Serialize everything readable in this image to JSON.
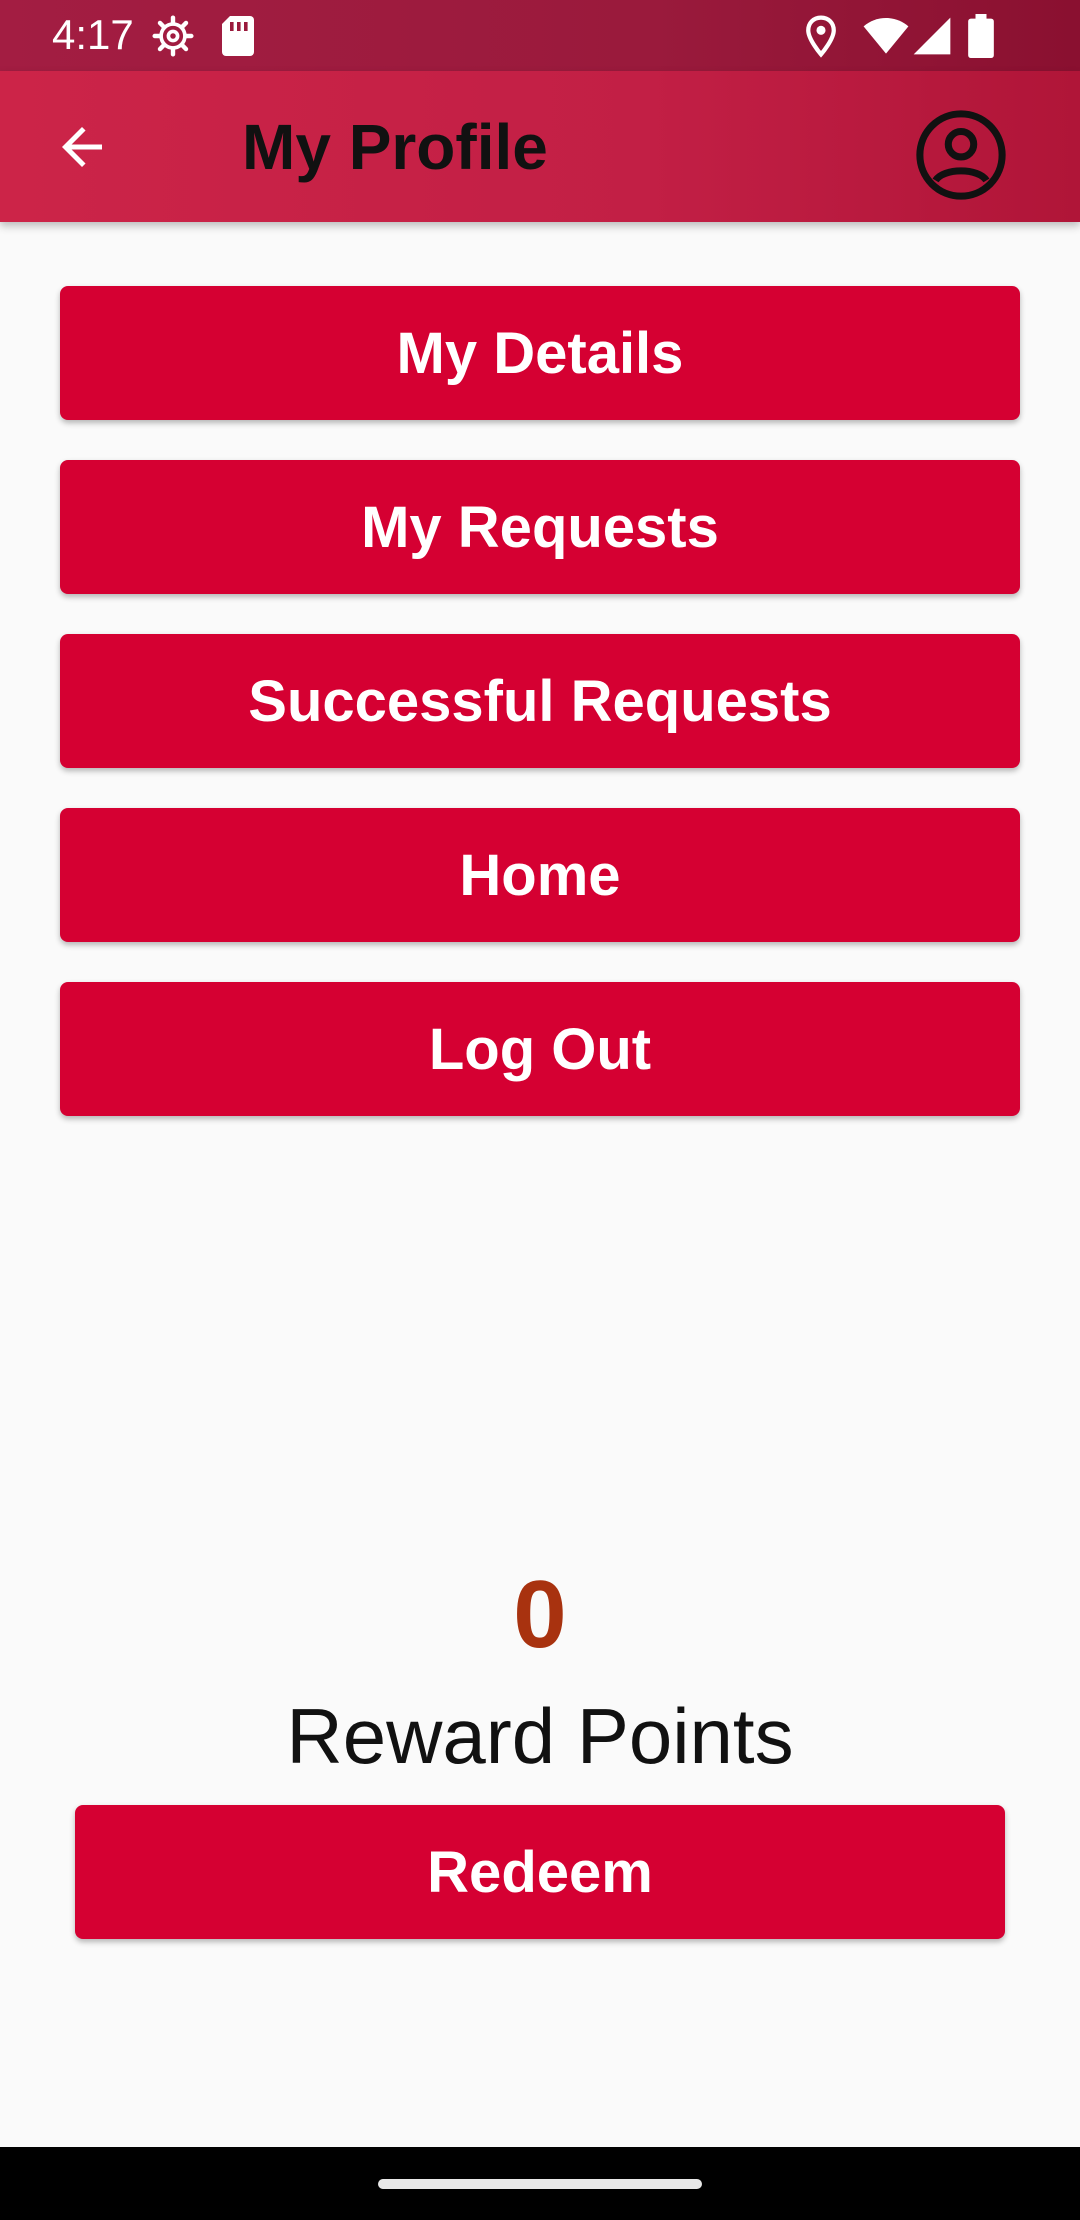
{
  "status_bar": {
    "time": "4:17",
    "left_icons": [
      "settings-gear-icon",
      "sd-card-icon"
    ],
    "right_icons": [
      "location-icon",
      "wifi-icon",
      "signal-icon",
      "battery-icon"
    ]
  },
  "app_bar": {
    "title": "My Profile",
    "back_icon": "arrow-back-icon",
    "profile_icon": "account-circle-icon",
    "colors": {
      "start": "#cc2448",
      "end": "#b01538"
    }
  },
  "menu": {
    "items": [
      {
        "label": "My Details"
      },
      {
        "label": "My Requests"
      },
      {
        "label": "Successful Requests"
      },
      {
        "label": "Home"
      },
      {
        "label": "Log Out"
      }
    ]
  },
  "rewards": {
    "points": "0",
    "label": "Reward Points",
    "redeem_label": "Redeem"
  },
  "colors": {
    "button": "#d50032",
    "points": "#a8320f",
    "background": "#fafafa"
  }
}
